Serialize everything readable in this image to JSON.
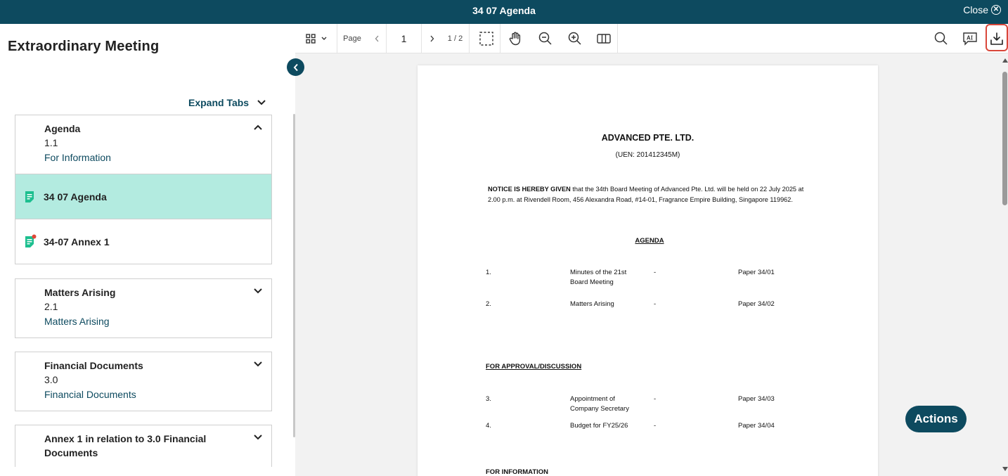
{
  "window": {
    "title": "34 07 Agenda",
    "close_label": "Close"
  },
  "sidebar": {
    "meeting_title": "Extraordinary Meeting",
    "expand_tabs_label": "Expand Tabs",
    "groups": [
      {
        "title": "Agenda",
        "number": "1.1",
        "subtitle": "For Information",
        "expanded": true,
        "documents": [
          "34 07 Agenda",
          "34-07 Annex 1"
        ]
      },
      {
        "title": "Matters Arising",
        "number": "2.1",
        "subtitle": "Matters Arising",
        "expanded": false
      },
      {
        "title": "Financial Documents",
        "number": "3.0",
        "subtitle": "Financial Documents",
        "expanded": false
      },
      {
        "title": "Annex 1 in relation to 3.0 Financial Documents",
        "expanded": false
      }
    ]
  },
  "toolbar": {
    "page_label": "Page",
    "page_number": "1",
    "page_count": "1 / 2"
  },
  "document": {
    "company": "ADVANCED PTE. LTD.",
    "uen": "(UEN: 201412345M)",
    "notice_bold": "NOTICE IS HEREBY GIVEN",
    "notice_rest": " that the 34th Board Meeting of Advanced Pte. Ltd. will be held on 22 July 2025 at 2.00 p.m. at Rivendell Room, 456 Alexandra Road, #14-01, Fragrance Empire Building, Singapore 119962.",
    "agenda_heading": "AGENDA",
    "items": [
      {
        "num": "1.",
        "desc": "Minutes of the 21st Board Meeting",
        "dash": "-",
        "paper": "Paper 34/01"
      },
      {
        "num": "2.",
        "desc": "Matters Arising",
        "dash": "-",
        "paper": "Paper 34/02"
      },
      {
        "num": "3.",
        "desc": "Appointment of Company Secretary",
        "dash": "-",
        "paper": "Paper 34/03"
      },
      {
        "num": "4.",
        "desc": "Budget for FY25/26",
        "dash": "-",
        "paper": "Paper 34/04"
      }
    ],
    "section_approval": "FOR APPROVAL/DISCUSSION",
    "section_information": "FOR INFORMATION"
  },
  "actions_label": "Actions",
  "colors": {
    "brand": "#0d4a5f",
    "active_row": "#b3ebe0",
    "highlight": "#d9473a",
    "doc_icon": "#1cbf8f"
  }
}
